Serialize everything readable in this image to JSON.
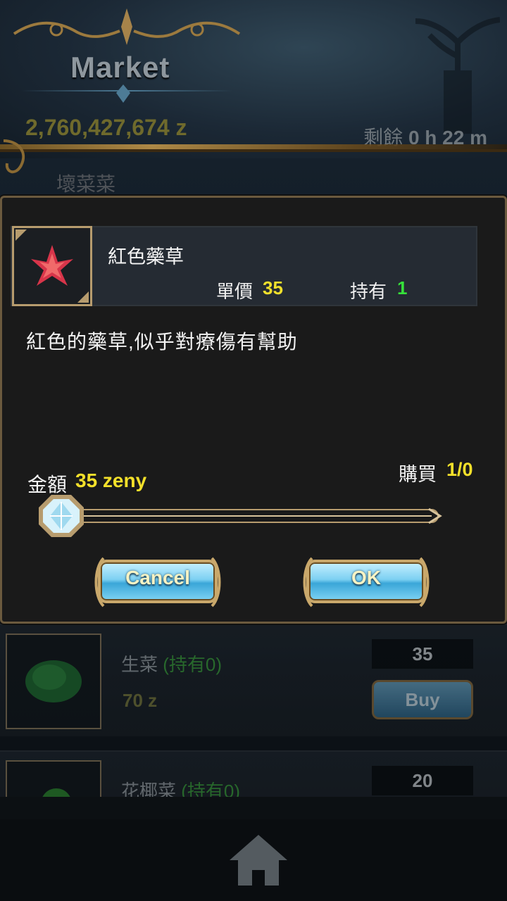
{
  "header": {
    "title": "Market",
    "money": "2,760,427,674 z",
    "timer_label": "剩餘",
    "timer_value": "0 h 22 m",
    "shop_name": "壞菜菜"
  },
  "dialog": {
    "item_name": "紅色藥草",
    "unit_price_label": "單價",
    "unit_price": "35",
    "owned_label": "持有",
    "owned": "1",
    "description": "紅色的藥草,似乎對療傷有幫助",
    "amount_label": "金額",
    "amount_value": "35 zeny",
    "purchase_label": "購買",
    "purchase_value": "1/0",
    "slider_fraction": 0,
    "cancel_label": "Cancel",
    "ok_label": "OK",
    "item_icon": "red-herb-icon"
  },
  "list": [
    {
      "name": "生菜",
      "owned": "(持有0)",
      "price": "70 z",
      "qty": "35",
      "buy_label": "Buy",
      "icon": "lettuce-icon"
    },
    {
      "name": "花椰菜",
      "owned": "(持有0)",
      "qty": "20",
      "icon": "broccoli-icon"
    }
  ],
  "nav": {
    "home_icon": "home-icon"
  },
  "colors": {
    "accent_yellow": "#f3e02a",
    "owned_green": "#36e13a",
    "frame_gold": "#b79c6e",
    "button_blue": "#7cd0f2"
  }
}
